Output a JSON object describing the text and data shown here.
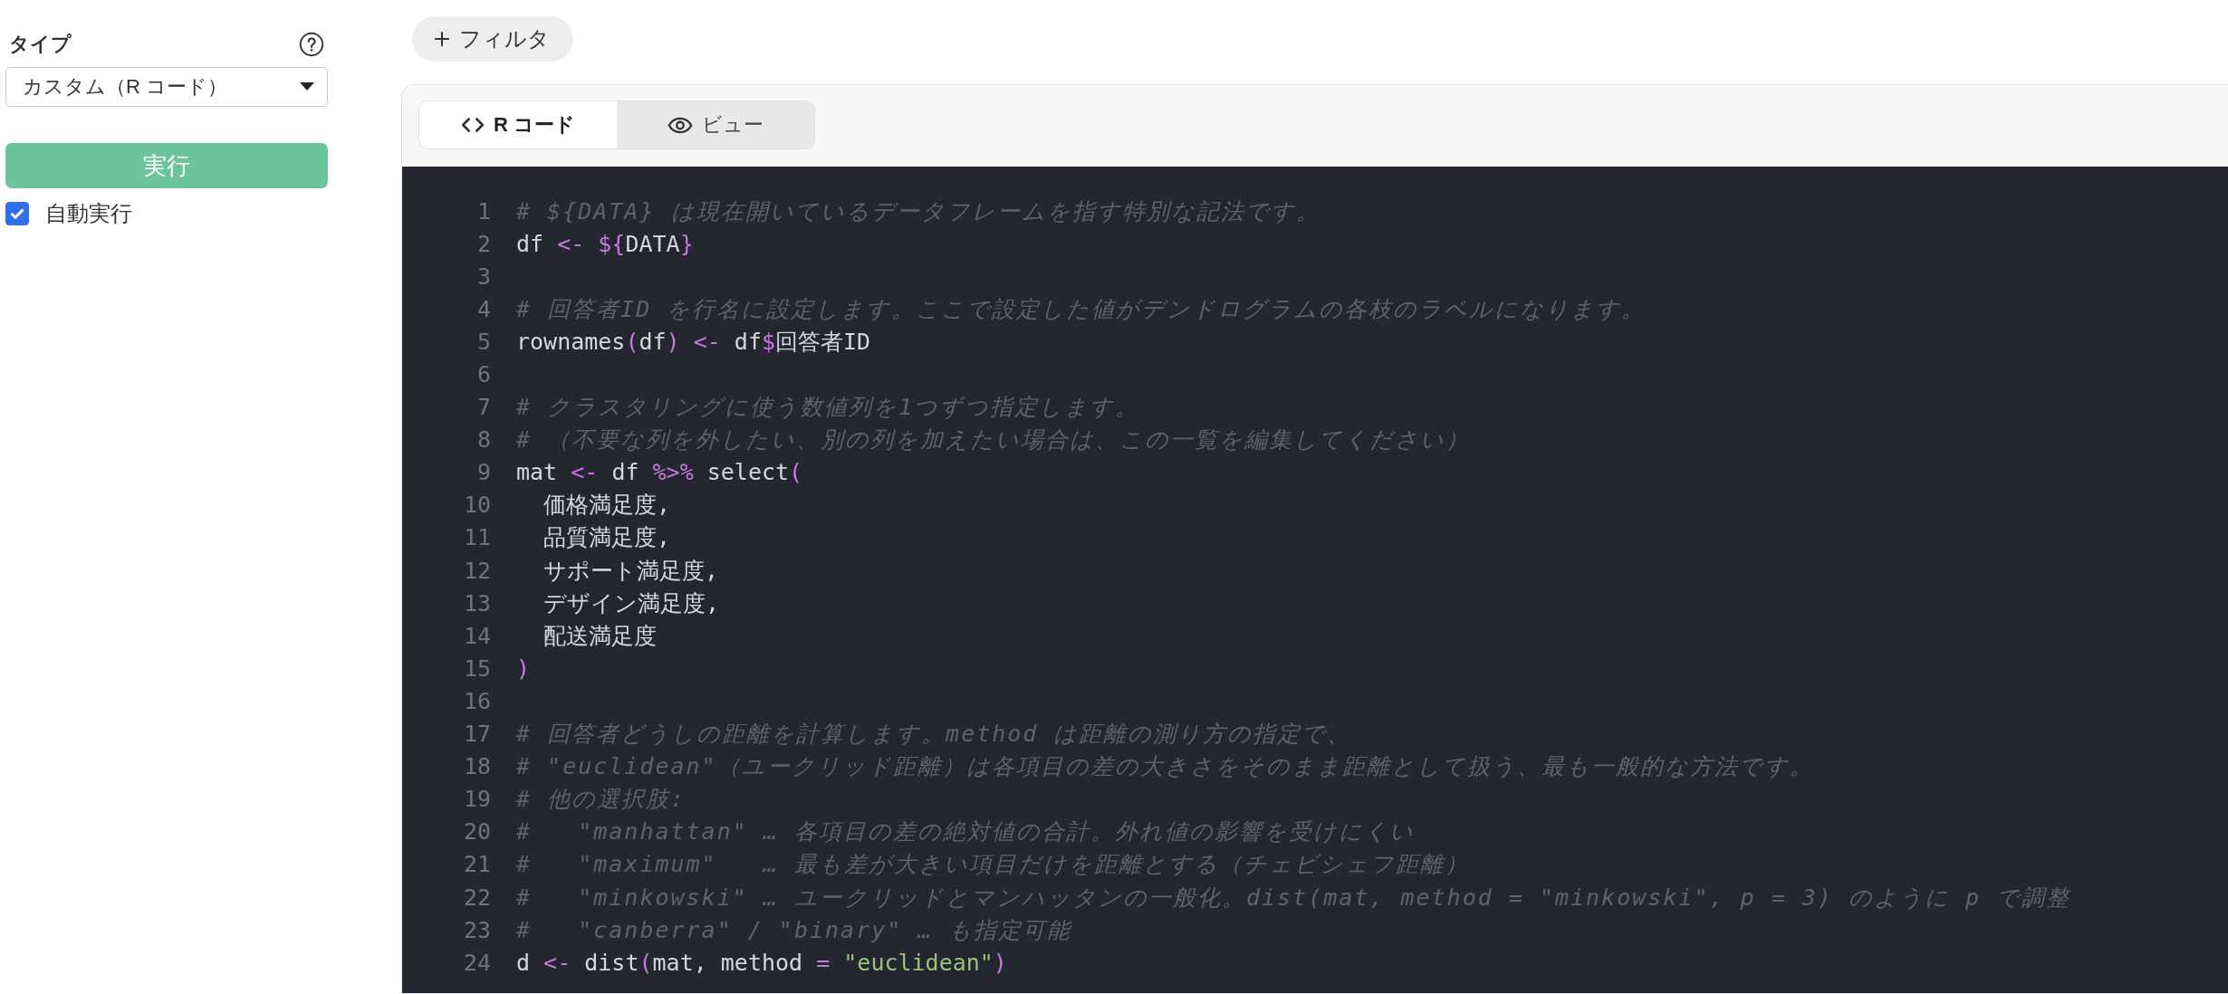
{
  "sidebar": {
    "type_label": "タイプ",
    "type_select": {
      "value": "カスタム（R コード）"
    },
    "run_button": "実行",
    "auto_run": {
      "label": "自動実行",
      "checked": true
    }
  },
  "filter_button": {
    "label": "フィルタ"
  },
  "editor": {
    "tabs": [
      {
        "label": "R コード",
        "kind": "code",
        "selected": true
      },
      {
        "label": "ビュー",
        "kind": "eye",
        "selected": false
      }
    ],
    "lines": [
      {
        "number": "1",
        "tokens": [
          {
            "text": "# ${DATA} は現在開いているデータフレームを指す特別な記法です。",
            "kind": "comment"
          }
        ]
      },
      {
        "number": "2",
        "tokens": [
          {
            "text": "df ",
            "kind": "plain"
          },
          {
            "text": "<- ${",
            "kind": "op"
          },
          {
            "text": "DATA",
            "kind": "plain"
          },
          {
            "text": "}",
            "kind": "op"
          }
        ]
      },
      {
        "number": "3"
      },
      {
        "number": "4",
        "tokens": [
          {
            "text": "# 回答者ID を行名に設定します。ここで設定した値がデンドログラムの各枝のラベルになります。",
            "kind": "comment"
          }
        ]
      },
      {
        "number": "5",
        "tokens": [
          {
            "text": "rownames",
            "kind": "plain"
          },
          {
            "text": "(",
            "kind": "op"
          },
          {
            "text": "df",
            "kind": "plain"
          },
          {
            "text": ") <-",
            "kind": "op"
          },
          {
            "text": " df",
            "kind": "plain"
          },
          {
            "text": "$",
            "kind": "op"
          },
          {
            "text": "回答者ID",
            "kind": "plain"
          }
        ]
      },
      {
        "number": "6"
      },
      {
        "number": "7",
        "tokens": [
          {
            "text": "# クラスタリングに使う数値列を1つずつ指定します。",
            "kind": "comment"
          }
        ]
      },
      {
        "number": "8",
        "tokens": [
          {
            "text": "# （不要な列を外したい、別の列を加えたい場合は、この一覧を編集してください）",
            "kind": "comment"
          }
        ]
      },
      {
        "number": "9",
        "tokens": [
          {
            "text": "mat ",
            "kind": "plain"
          },
          {
            "text": "<-",
            "kind": "op"
          },
          {
            "text": " df ",
            "kind": "plain"
          },
          {
            "text": "%>%",
            "kind": "op"
          },
          {
            "text": " select",
            "kind": "plain"
          },
          {
            "text": "(",
            "kind": "op"
          }
        ]
      },
      {
        "number": "10",
        "tokens": [
          {
            "text": "  価格満足度,",
            "kind": "plain"
          }
        ]
      },
      {
        "number": "11",
        "tokens": [
          {
            "text": "  品質満足度,",
            "kind": "plain"
          }
        ]
      },
      {
        "number": "12",
        "tokens": [
          {
            "text": "  サポート満足度,",
            "kind": "plain"
          }
        ]
      },
      {
        "number": "13",
        "tokens": [
          {
            "text": "  デザイン満足度,",
            "kind": "plain"
          }
        ]
      },
      {
        "number": "14",
        "tokens": [
          {
            "text": "  配送満足度",
            "kind": "plain"
          }
        ]
      },
      {
        "number": "15",
        "tokens": [
          {
            "text": ")",
            "kind": "op"
          }
        ]
      },
      {
        "number": "16"
      },
      {
        "number": "17",
        "tokens": [
          {
            "text": "# 回答者どうしの距離を計算します。method は距離の測り方の指定で、",
            "kind": "comment"
          }
        ]
      },
      {
        "number": "18",
        "tokens": [
          {
            "text": "# \"euclidean\"（ユークリッド距離）は各項目の差の大きさをそのまま距離として扱う、最も一般的な方法です。",
            "kind": "comment"
          }
        ]
      },
      {
        "number": "19",
        "tokens": [
          {
            "text": "# 他の選択肢:",
            "kind": "comment"
          }
        ]
      },
      {
        "number": "20",
        "tokens": [
          {
            "text": "#   \"manhattan\" … 各項目の差の絶対値の合計。外れ値の影響を受けにくい",
            "kind": "comment"
          }
        ]
      },
      {
        "number": "21",
        "tokens": [
          {
            "text": "#   \"maximum\"   … 最も差が大きい項目だけを距離とする（チェビシェフ距離）",
            "kind": "comment"
          }
        ]
      },
      {
        "number": "22",
        "tokens": [
          {
            "text": "#   \"minkowski\" … ユークリッドとマンハッタンの一般化。dist(mat, method = \"minkowski\", p = 3) のように p で調整",
            "kind": "comment"
          }
        ]
      },
      {
        "number": "23",
        "tokens": [
          {
            "text": "#   \"canberra\" / \"binary\" … も指定可能",
            "kind": "comment"
          }
        ]
      },
      {
        "number": "24",
        "tokens": [
          {
            "text": "d ",
            "kind": "plain"
          },
          {
            "text": "<-",
            "kind": "op"
          },
          {
            "text": " dist",
            "kind": "plain"
          },
          {
            "text": "(",
            "kind": "op"
          },
          {
            "text": "mat, method ",
            "kind": "plain"
          },
          {
            "text": "= ",
            "kind": "op"
          },
          {
            "text": "\"euclidean\"",
            "kind": "string"
          },
          {
            "text": ")",
            "kind": "op"
          }
        ]
      }
    ]
  }
}
